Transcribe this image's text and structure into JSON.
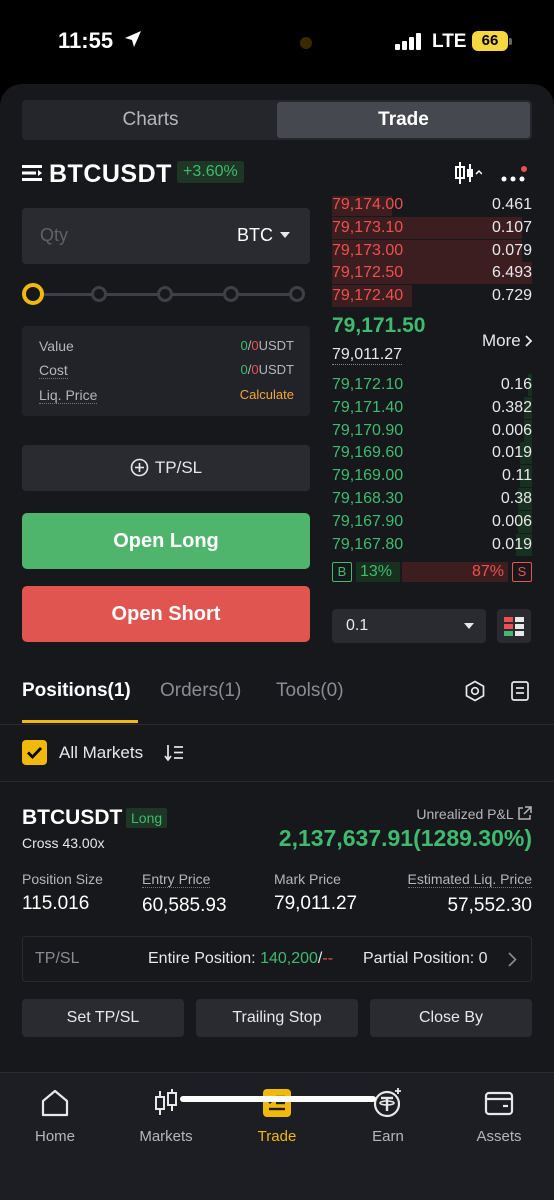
{
  "status": {
    "time": "11:55",
    "network": "LTE",
    "battery": "66"
  },
  "segment": {
    "charts": "Charts",
    "trade": "Trade"
  },
  "symbol": {
    "name": "BTCUSDT",
    "change": "+3.60%"
  },
  "order": {
    "qty_placeholder": "Qty",
    "qty_unit": "BTC",
    "info": {
      "value_label": "Value",
      "value_a": "0",
      "value_b": "0",
      "value_unit": "USDT",
      "cost_label": "Cost",
      "cost_a": "0",
      "cost_b": "0",
      "cost_unit": "USDT",
      "liq_label": "Liq. Price",
      "liq_action": "Calculate"
    },
    "tpsl_label": "TP/SL",
    "open_long": "Open Long",
    "open_short": "Open Short"
  },
  "orderbook": {
    "asks": [
      {
        "price": "79,174.00",
        "qty": "0.461",
        "depth": 0.3
      },
      {
        "price": "79,173.10",
        "qty": "0.107",
        "depth": 0.95
      },
      {
        "price": "79,173.00",
        "qty": "0.079",
        "depth": 0.95
      },
      {
        "price": "79,172.50",
        "qty": "6.493",
        "depth": 1.0
      },
      {
        "price": "79,172.40",
        "qty": "0.729",
        "depth": 0.4
      }
    ],
    "last_price": "79,171.50",
    "mark_price": "79,011.27",
    "more_label": "More",
    "bids": [
      {
        "price": "79,172.10",
        "qty": "0.16",
        "depth": 0.02
      },
      {
        "price": "79,171.40",
        "qty": "0.382",
        "depth": 0.04
      },
      {
        "price": "79,170.90",
        "qty": "0.006",
        "depth": 0.04
      },
      {
        "price": "79,169.60",
        "qty": "0.019",
        "depth": 0.06
      },
      {
        "price": "79,169.00",
        "qty": "0.11",
        "depth": 0.06
      },
      {
        "price": "79,168.30",
        "qty": "0.38",
        "depth": 0.07
      },
      {
        "price": "79,167.90",
        "qty": "0.006",
        "depth": 0.07
      },
      {
        "price": "79,167.80",
        "qty": "0.019",
        "depth": 0.08
      }
    ],
    "buy_label": "B",
    "buy_pct": "13%",
    "sell_label": "S",
    "sell_pct": "87%",
    "depth_value": "0.1"
  },
  "tabs": {
    "positions": "Positions(1)",
    "orders": "Orders(1)",
    "tools": "Tools(0)"
  },
  "filter": {
    "label": "All Markets"
  },
  "position": {
    "symbol": "BTCUSDT",
    "side": "Long",
    "mode": "Cross 43.00x",
    "upnl_label": "Unrealized P&L",
    "upnl_value": "2,137,637.91(1289.30%)",
    "size_label": "Position Size",
    "size_value": "115.016",
    "entry_label": "Entry Price",
    "entry_value": "60,585.93",
    "mark_label": "Mark Price",
    "mark_value": "79,011.27",
    "liq_label": "Estimated Liq. Price",
    "liq_value": "57,552.30",
    "tpsl_label": "TP/SL",
    "entire_label": "Entire Position:",
    "entire_tp": "140,200",
    "entire_sl": "--",
    "partial_label": "Partial Position: 0",
    "btn_set_tpsl": "Set TP/SL",
    "btn_trailing": "Trailing Stop",
    "btn_close_by": "Close By"
  },
  "nav": {
    "home": "Home",
    "markets": "Markets",
    "trade": "Trade",
    "earn": "Earn",
    "assets": "Assets"
  },
  "colors": {
    "green": "#3fbb6f",
    "red": "#ef4f4f",
    "accent": "#f0b90b"
  }
}
